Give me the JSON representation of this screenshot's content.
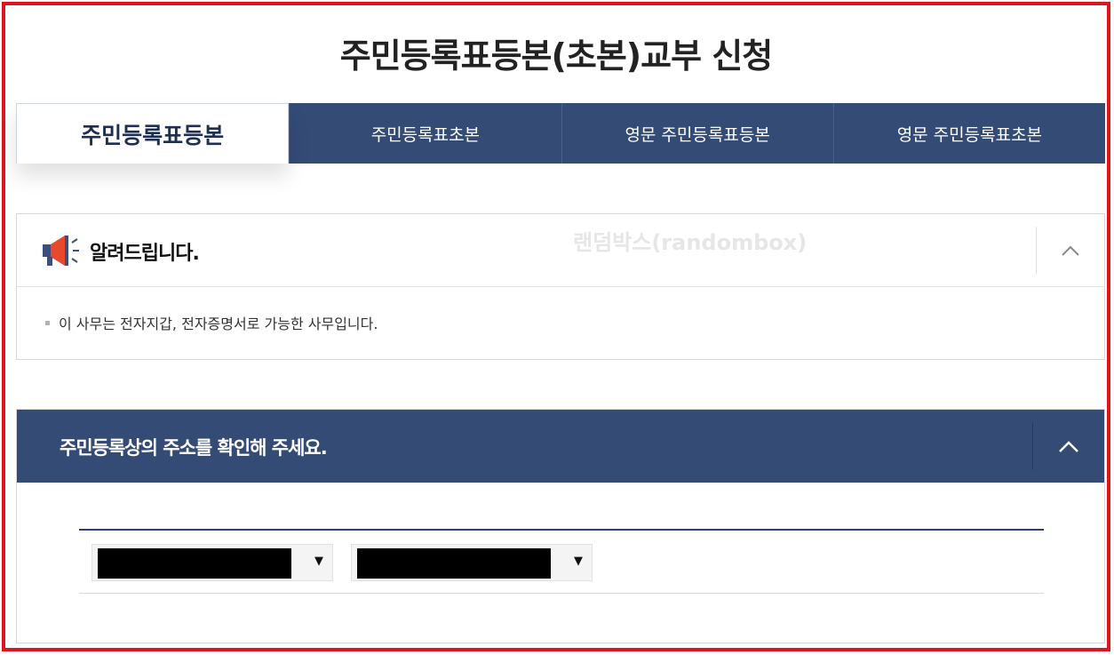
{
  "page": {
    "title": "주민등록표등본(초본)교부 신청"
  },
  "tabs": [
    {
      "label": "주민등록표등본",
      "active": true
    },
    {
      "label": "주민등록표초본",
      "active": false
    },
    {
      "label": "영문 주민등록표등본",
      "active": false
    },
    {
      "label": "영문 주민등록표초본",
      "active": false
    }
  ],
  "notice": {
    "title": "알려드립니다.",
    "watermark": "랜덤박스(randombox)",
    "body": "이 사무는 전자지갑, 전자증명서로 가능한 사무입니다.",
    "icon": "megaphone-icon",
    "collapse_icon": "chevron-up-icon"
  },
  "address": {
    "title": "주민등록상의 주소를 확인해 주세요.",
    "collapse_icon": "chevron-up-icon",
    "select1_value": "",
    "select2_value": "",
    "arrow": "▼"
  },
  "colors": {
    "frame": "#e0141c",
    "navy": "#344b76",
    "megaphone": "#e8482b"
  }
}
